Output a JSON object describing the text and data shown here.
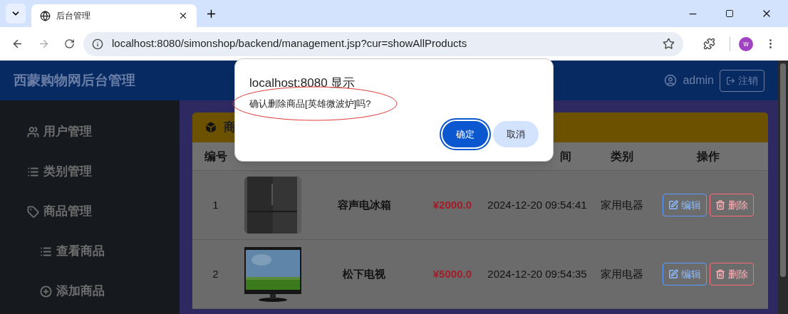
{
  "browser": {
    "tabs": [
      {
        "title": "后台管理",
        "selected": true
      }
    ],
    "url": "localhost:8080/simonshop/backend/management.jsp?cur=showAllProducts",
    "profile_initial": "w"
  },
  "navbar": {
    "title": "西蒙购物网后台管理",
    "user": "admin",
    "logout": "注销"
  },
  "sidebar": {
    "items": [
      {
        "kind": "users",
        "label": "用户管理"
      },
      {
        "kind": "list",
        "label": "类别管理"
      },
      {
        "kind": "tag",
        "label": "商品管理",
        "children": [
          {
            "kind": "list",
            "label": "查看商品"
          },
          {
            "kind": "add",
            "label": "添加商品"
          }
        ]
      }
    ]
  },
  "card": {
    "title": "商"
  },
  "table": {
    "columns": [
      "编号",
      "间",
      "类别",
      "操作"
    ],
    "rows": [
      {
        "no": "1",
        "kind": "picture",
        "name": "容声电冰箱",
        "price": "¥2000.0",
        "time": "2024-12-20 09:54:41",
        "category": "家用电器",
        "actions": [
          "编辑",
          "删除"
        ]
      },
      {
        "no": "2",
        "kind": "picture",
        "name": "松下电视",
        "price": "¥5000.0",
        "time": "2024-12-20 09:54:35",
        "category": "家用电器",
        "actions": [
          "编辑",
          "删除"
        ]
      }
    ]
  },
  "dialog": {
    "title": "localhost:8080 显示",
    "message": "确认删除商品[英雄微波炉]吗?",
    "buttons": [
      {
        "label": "确定",
        "primary": true
      },
      {
        "label": "取消",
        "primary": false
      }
    ]
  }
}
